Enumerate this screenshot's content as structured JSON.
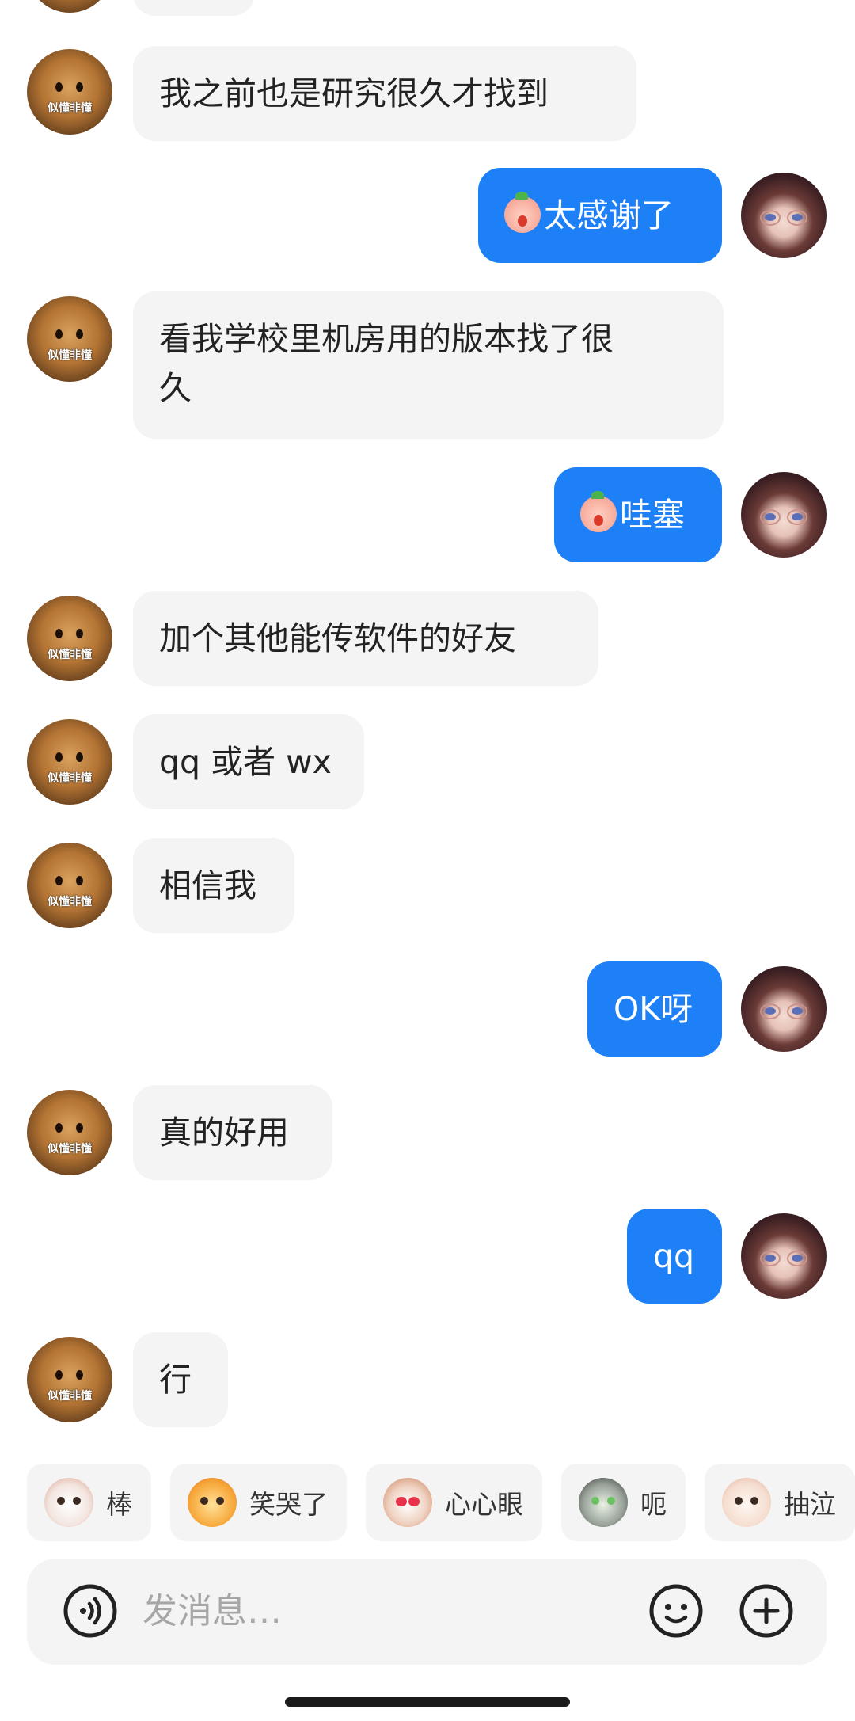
{
  "messages": [
    {
      "side": "left",
      "text": "我之前也是研究很久才找到",
      "avatar_caption": "似懂非懂"
    },
    {
      "side": "right",
      "text": "太感谢了",
      "sticker": "peach-sticker"
    },
    {
      "side": "left",
      "text": "看我学校里机房用的版本找了很\n久",
      "avatar_caption": "似懂非懂"
    },
    {
      "side": "right",
      "text": "哇塞",
      "sticker": "peach-sticker"
    },
    {
      "side": "left",
      "text": "加个其他能传软件的好友",
      "avatar_caption": "似懂非懂"
    },
    {
      "side": "left",
      "text": "qq 或者 wx",
      "avatar_caption": "似懂非懂"
    },
    {
      "side": "left",
      "text": "相信我",
      "avatar_caption": "似懂非懂"
    },
    {
      "side": "right",
      "text": "OK呀"
    },
    {
      "side": "left",
      "text": "真的好用",
      "avatar_caption": "似懂非懂"
    },
    {
      "side": "right",
      "text": "qq"
    },
    {
      "side": "left",
      "text": "行",
      "avatar_caption": "似懂非懂"
    }
  ],
  "quick_reactions": [
    {
      "label": "棒",
      "icon": "cat-wow-icon"
    },
    {
      "label": "笑哭了",
      "icon": "cat-laugh-cry-icon"
    },
    {
      "label": "心心眼",
      "icon": "cat-heart-eyes-icon"
    },
    {
      "label": "呃",
      "icon": "cat-awkward-icon"
    },
    {
      "label": "抽泣",
      "icon": "cat-sob-icon"
    }
  ],
  "input": {
    "placeholder": "发消息…",
    "voice_icon": "voice-icon",
    "emoji_icon": "emoji-icon",
    "plus_icon": "plus-icon"
  },
  "colors": {
    "outgoing_bubble": "#1e80f7",
    "incoming_bubble": "#f4f4f4",
    "background": "#ffffff"
  }
}
